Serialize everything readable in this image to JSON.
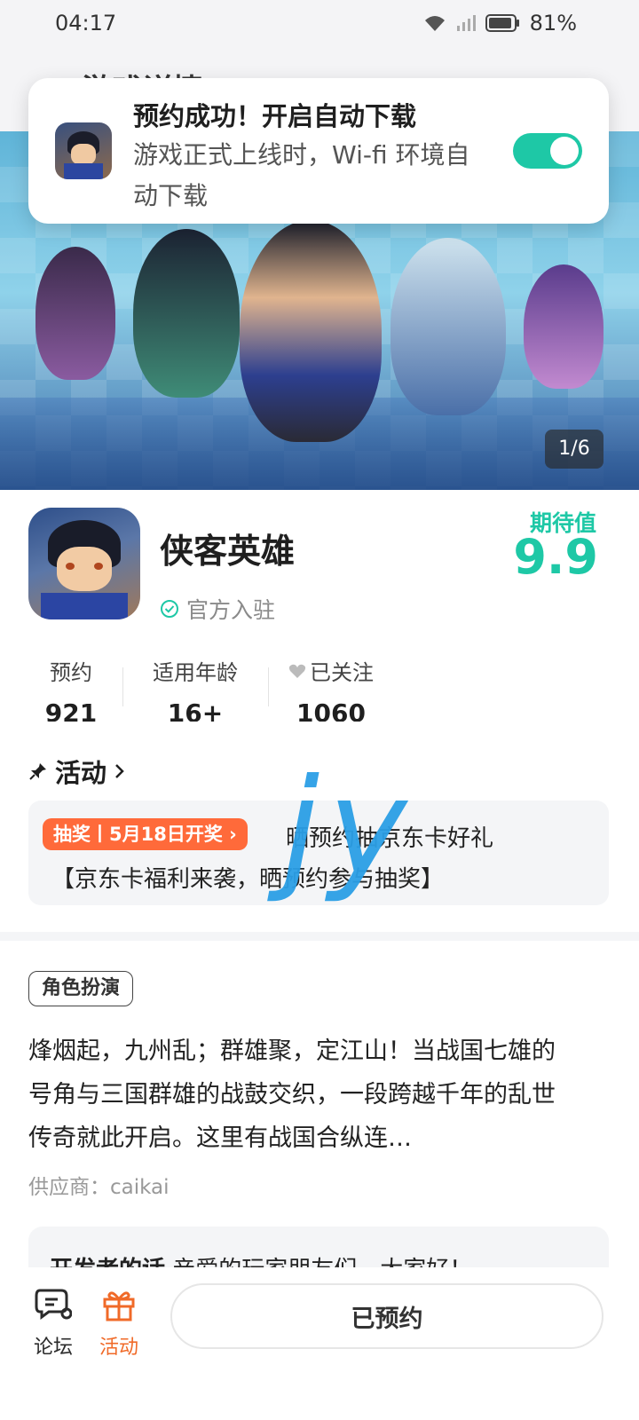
{
  "status_bar": {
    "time": "04:17",
    "battery_pct": "81%",
    "icons": [
      "wifi-icon",
      "signal-icon",
      "battery-icon"
    ]
  },
  "header": {
    "title": "<-游戏详情"
  },
  "toast": {
    "title": "预约成功！开启自动下载",
    "text": "游戏正式上线时，Wi-fi 环境自动下载",
    "toggle_on": true
  },
  "hero": {
    "counter": "1/6"
  },
  "game": {
    "name": "侠客英雄",
    "official_label": "官方入驻",
    "expect_label": "期待值",
    "expect_value": "9.9"
  },
  "stats": [
    {
      "label": "预约",
      "value": "921"
    },
    {
      "label": "适用年龄",
      "value": "16+"
    },
    {
      "label": "已关注",
      "value": "1060"
    }
  ],
  "activity": {
    "title": "活动",
    "badge": "抽奖丨5月18日开奖",
    "line1": "晒预约抽京东卡好礼",
    "line2": "【京东卡福利来袭，晒预约参与抽奖】"
  },
  "watermark": "jy",
  "description": {
    "tag": "角色扮演",
    "text": "烽烟起，九州乱；群雄聚，定江山！当战国七雄的号角与三国群雄的战鼓交织，一段跨越千年的乱世传奇就此开启。这里有战国合纵连…",
    "supplier": "供应商：caikai"
  },
  "developer": {
    "title": "开发者的话",
    "text": "亲爱的玩家朋友们，大家好！"
  },
  "bottom": {
    "forum_label": "论坛",
    "activity_label": "活动",
    "reserved_label": "已预约"
  },
  "colors": {
    "accent": "#1ec8a6",
    "activity_tab": "#f06a28",
    "badge": "#ff6a3a",
    "watermark": "#2b9fe6"
  }
}
